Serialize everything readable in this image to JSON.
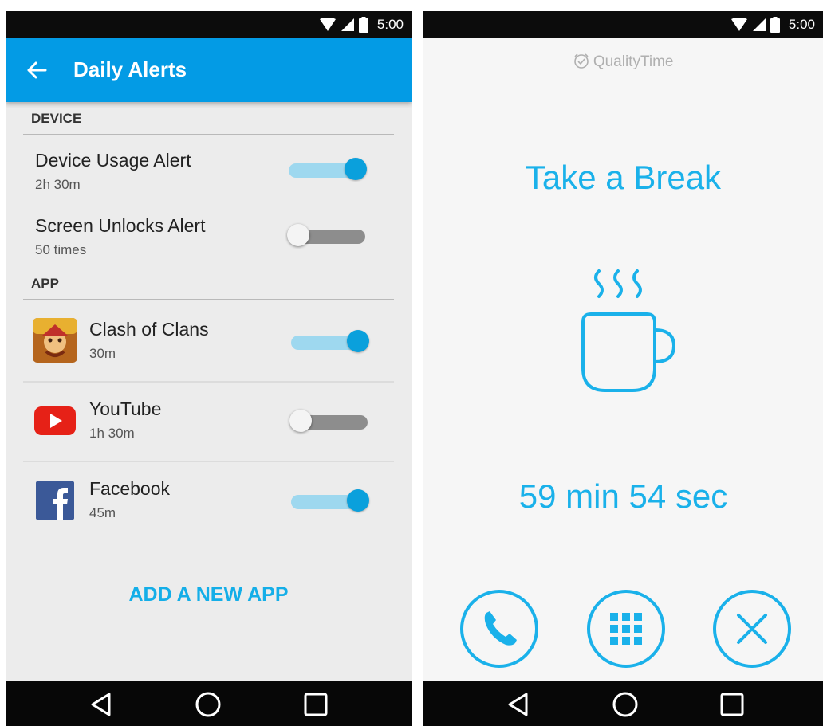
{
  "status_bar": {
    "time": "5:00"
  },
  "daily_alerts": {
    "title": "Daily Alerts",
    "sections": {
      "device": {
        "header": "DEVICE",
        "items": [
          {
            "name": "Device Usage Alert",
            "value": "2h 30m",
            "enabled": true
          },
          {
            "name": "Screen Unlocks Alert",
            "value": "50 times",
            "enabled": false
          }
        ]
      },
      "app": {
        "header": "APP",
        "items": [
          {
            "name": "Clash of Clans",
            "value": "30m",
            "icon": "clash-of-clans-icon",
            "enabled": true
          },
          {
            "name": "YouTube",
            "value": "1h 30m",
            "icon": "youtube-icon",
            "enabled": false
          },
          {
            "name": "Facebook",
            "value": "45m",
            "icon": "facebook-icon",
            "enabled": true
          }
        ]
      }
    },
    "add_app_label": "ADD A NEW APP"
  },
  "take_a_break": {
    "logo_text": "QualityTime",
    "title": "Take a Break",
    "countdown": "59 min 54 sec",
    "buttons": [
      "phone-icon",
      "app-grid-icon",
      "close-icon"
    ]
  },
  "nav_bar": {
    "buttons": [
      "back-icon",
      "home-icon",
      "recents-icon"
    ]
  },
  "colors": {
    "app_bar": "#039be5",
    "accent": "#1ab1ea",
    "switch_on_thumb": "#0aa0dc",
    "switch_on_track": "#9ed8ef",
    "switch_off_track": "#8d8d8d"
  }
}
